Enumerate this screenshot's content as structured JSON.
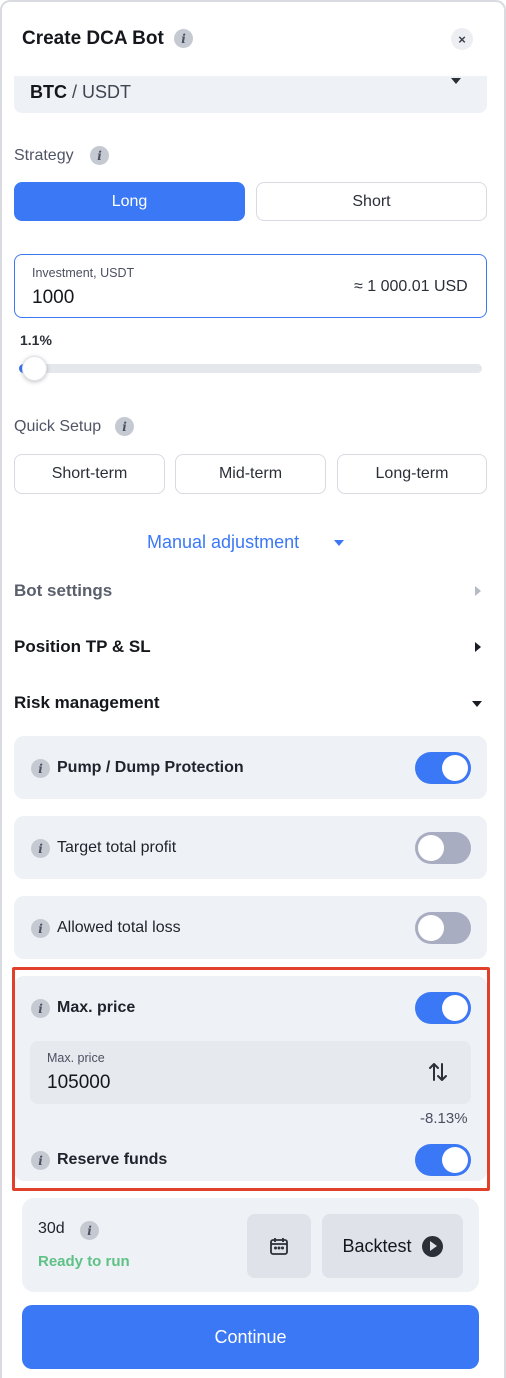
{
  "header": {
    "title": "Create DCA Bot",
    "close_symbol": "×"
  },
  "pair": {
    "base": "BTC",
    "separator": " / ",
    "quote": "USDT"
  },
  "strategy": {
    "label": "Strategy",
    "options": [
      "Long",
      "Short"
    ],
    "selected": "Long"
  },
  "investment": {
    "label": "Investment, USDT",
    "value": "1000",
    "approx_usd": "≈ 1 000.01 USD"
  },
  "slider": {
    "percent_label": "1.1%",
    "fraction": 0.011
  },
  "quick_setup": {
    "label": "Quick Setup",
    "options": [
      "Short-term",
      "Mid-term",
      "Long-term"
    ]
  },
  "manual_adjustment": {
    "label": "Manual adjustment"
  },
  "sections": {
    "bot_settings": "Bot settings",
    "position_tp_sl": "Position TP & SL",
    "risk_management": "Risk management"
  },
  "risk": {
    "pump_dump": {
      "label": "Pump / Dump Protection",
      "on": true
    },
    "target_profit": {
      "label": "Target total profit",
      "on": false
    },
    "allowed_loss": {
      "label": "Allowed total loss",
      "on": false
    },
    "max_price": {
      "label": "Max. price",
      "on": true,
      "field_label": "Max. price",
      "field_value": "105000",
      "percent": "-8.13%"
    },
    "reserve_funds": {
      "label": "Reserve funds",
      "on": true
    }
  },
  "backtest": {
    "period": "30d",
    "status": "Ready to run",
    "button_label": "Backtest"
  },
  "continue_label": "Continue",
  "colors": {
    "accent": "#3b78f6",
    "highlight": "#e1412b",
    "success": "#5fc186",
    "toggle_off": "#a9adc1"
  }
}
